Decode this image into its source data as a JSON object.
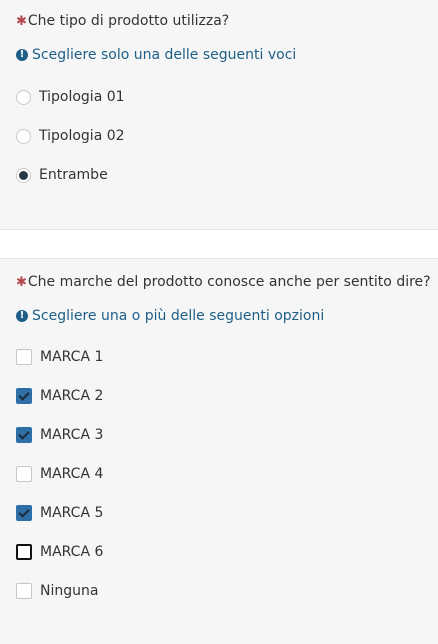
{
  "q1": {
    "asterisk": "✱",
    "question": "Che tipo di prodotto utilizza?",
    "help": "Scegliere solo una delle seguenti voci",
    "options": [
      {
        "label": "Tipologia 01",
        "selected": false
      },
      {
        "label": "Tipologia 02",
        "selected": false
      },
      {
        "label": "Entrambe",
        "selected": true
      }
    ]
  },
  "q2": {
    "asterisk": "✱",
    "question": "Che marche del prodotto conosce anche per sentito dire?",
    "help": "Scegliere una o più delle seguenti opzioni",
    "options": [
      {
        "label": "MARCA 1",
        "checked": false
      },
      {
        "label": "MARCA 2",
        "checked": true
      },
      {
        "label": "MARCA 3",
        "checked": true
      },
      {
        "label": "MARCA 4",
        "checked": false
      },
      {
        "label": "MARCA 5",
        "checked": true
      },
      {
        "label": "MARCA 6",
        "checked": false,
        "focused": true
      },
      {
        "label": "Ninguna",
        "checked": false
      }
    ]
  },
  "colors": {
    "required": "#b5444b",
    "help": "#1e5f87",
    "checkbox_checked": "#2f6fa8",
    "radio_dot": "#2a3947",
    "panel_bg": "#f6f6f6"
  },
  "icons": {
    "help": "exclamation-circle-icon",
    "required": "asterisk-icon"
  }
}
